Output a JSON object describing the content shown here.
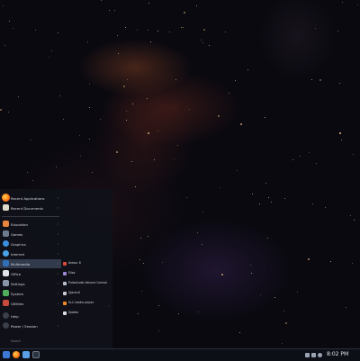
{
  "launcher": {
    "recent": [
      {
        "label": "Recent Applications",
        "icon": "firefox-icon"
      },
      {
        "label": "Recent Documents",
        "icon": "documents-icon"
      }
    ],
    "categories": [
      {
        "label": "Education",
        "icon": "education-icon"
      },
      {
        "label": "Games",
        "icon": "games-icon"
      },
      {
        "label": "Graphics",
        "icon": "graphics-icon"
      },
      {
        "label": "Internet",
        "icon": "internet-icon"
      },
      {
        "label": "Multimedia",
        "icon": "multimedia-icon",
        "active": true
      },
      {
        "label": "Office",
        "icon": "office-icon"
      },
      {
        "label": "Settings",
        "icon": "settings-icon"
      },
      {
        "label": "System",
        "icon": "system-icon"
      },
      {
        "label": "Utilities",
        "icon": "utilities-icon"
      },
      {
        "label": "Help",
        "icon": "help-icon"
      },
      {
        "label": "Power / Session",
        "icon": "power-icon"
      }
    ],
    "apps": [
      {
        "label": "Ardour 8",
        "icon": "ardour-icon"
      },
      {
        "label": "Elisa",
        "icon": "elisa-icon"
      },
      {
        "label": "PulseAudio Volume Control",
        "icon": "volume-control-icon"
      },
      {
        "label": "Qjackctl",
        "icon": "qjackctl-icon"
      },
      {
        "label": "VLC media player",
        "icon": "vlc-icon"
      },
      {
        "label": "Xjadeo",
        "icon": "xjadeo-icon"
      }
    ],
    "search_placeholder": "Search"
  },
  "taskbar": {
    "clock": "8:02 PM",
    "pinned": [
      "start-menu-icon",
      "firefox-icon",
      "files-icon",
      "terminal-icon"
    ],
    "tray": [
      "network-icon",
      "volume-icon",
      "notifications-icon"
    ]
  },
  "colors": {
    "panel_bg": "#10121a",
    "active_item": "#50607a",
    "accent": "#3d7ad8"
  }
}
